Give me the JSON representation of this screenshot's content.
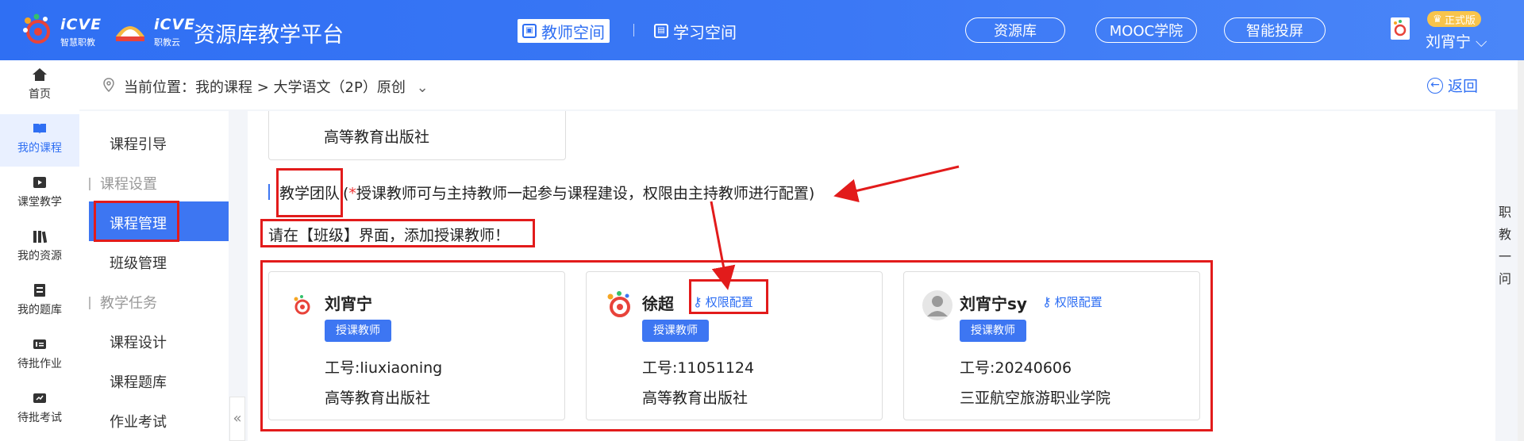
{
  "header": {
    "logo1_text": "iCVE",
    "logo1_sub": "智慧职教",
    "logo2_text": "iCVE",
    "logo2_sub": "职教云",
    "platform_title": "资源库教学平台",
    "tabs": [
      {
        "label": "教师空间",
        "active": true
      },
      {
        "label": "学习空间",
        "active": false
      }
    ],
    "pills": [
      "资源库",
      "MOOC学院",
      "智能投屏"
    ],
    "version_badge": "正式版",
    "user_name": "刘宵宁 ⌵"
  },
  "leftnav": {
    "items": [
      {
        "label": "首页",
        "icon": "home-icon"
      },
      {
        "label": "我的课程",
        "icon": "book-icon",
        "active": true
      },
      {
        "label": "课堂教学",
        "icon": "play-icon"
      },
      {
        "label": "我的资源",
        "icon": "library-icon"
      },
      {
        "label": "我的题库",
        "icon": "question-bank-icon"
      },
      {
        "label": "待批作业",
        "icon": "homework-icon"
      },
      {
        "label": "待批考试",
        "icon": "exam-icon"
      }
    ]
  },
  "breadcrumb": {
    "text": "当前位置：我的课程 > 大学语文（2P）原创",
    "back_label": "返回"
  },
  "submenu": {
    "items": [
      {
        "label": "课程引导",
        "type": "item"
      },
      {
        "label": "课程设置",
        "type": "group"
      },
      {
        "label": "课程管理",
        "type": "item",
        "active": true
      },
      {
        "label": "班级管理",
        "type": "item"
      },
      {
        "label": "教学任务",
        "type": "group"
      },
      {
        "label": "课程设计",
        "type": "item"
      },
      {
        "label": "课程题库",
        "type": "item"
      },
      {
        "label": "作业考试",
        "type": "item"
      }
    ]
  },
  "main": {
    "prev_card_text": "高等教育出版社",
    "section_title": "教学团队",
    "section_note_prefix": "(",
    "section_note_star": "*",
    "section_note_body": "授课教师可与主持教师一起参与课程建设，权限由主持教师进行配置)",
    "hint": "请在【班级】界面，添加授课教师！",
    "cards": [
      {
        "name": "刘宵宁",
        "role": "授课教师",
        "id": "工号:liuxiaoning",
        "org": "高等教育出版社",
        "perm": ""
      },
      {
        "name": "徐超",
        "role": "授课教师",
        "id": "工号:11051124",
        "org": "高等教育出版社",
        "perm": "权限配置"
      },
      {
        "name": "刘宵宁sy",
        "role": "授课教师",
        "id": "工号:20240606",
        "org": "三亚航空旅游职业学院",
        "perm": "权限配置"
      }
    ]
  },
  "side_float": "职教一问",
  "colors": {
    "primary": "#2f6ff3",
    "annotation": "#e21b1b",
    "badge": "#f8c44b"
  }
}
